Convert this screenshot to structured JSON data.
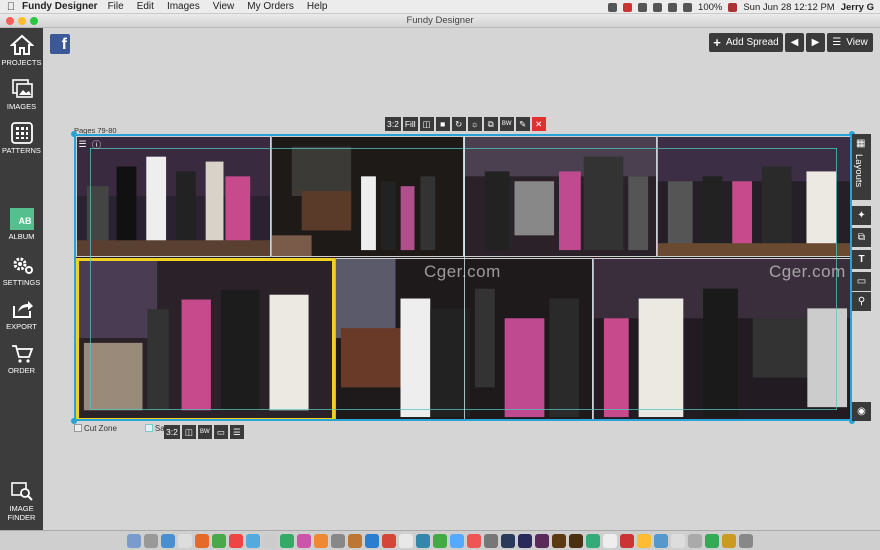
{
  "menubar": {
    "apple": "",
    "app_name": "Fundy Designer",
    "items": [
      "File",
      "Edit",
      "Images",
      "View",
      "My Orders",
      "Help"
    ],
    "battery": "100%",
    "datetime": "Sun Jun 28  12:12 PM",
    "user": "Jerry G"
  },
  "window": {
    "title": "Fundy Designer"
  },
  "sidebar": {
    "items": [
      {
        "label": "PROJECTS",
        "icon": "home-icon"
      },
      {
        "label": "IMAGES",
        "icon": "images-icon"
      },
      {
        "label": "PATTERNS",
        "icon": "grid-icon"
      },
      {
        "label": "ALBUM",
        "icon": "album-icon",
        "badge": "AB",
        "active": true
      },
      {
        "label": "SETTINGS",
        "icon": "gear-icon"
      },
      {
        "label": "EXPORT",
        "icon": "export-icon"
      },
      {
        "label": "ORDER",
        "icon": "cart-icon"
      },
      {
        "label": "IMAGE\nFINDER",
        "icon": "image-finder-icon"
      }
    ]
  },
  "toolbar": {
    "add_spread": "Add Spread",
    "view": "View",
    "social_icon": "facebook-icon"
  },
  "spread": {
    "pages_label": "Pages 79-80",
    "top_toolbar": {
      "ratio": "3:2",
      "fill": "Fill"
    },
    "bottom_toolbar": {
      "ratio": "3:2"
    },
    "watermark": "Cger.com"
  },
  "right_panel": {
    "layouts": "Layouts"
  },
  "legend": {
    "cut_zone": "Cut Zone",
    "safe_zone": "Safe Z"
  },
  "colors": {
    "selection_border": "#29a3d6",
    "selected_photo": "#f0d020",
    "safe_guide": "#50c8be",
    "sidebar_bg": "#3c3c3c",
    "album_accent": "#55c08d",
    "close_red": "#e03030"
  }
}
